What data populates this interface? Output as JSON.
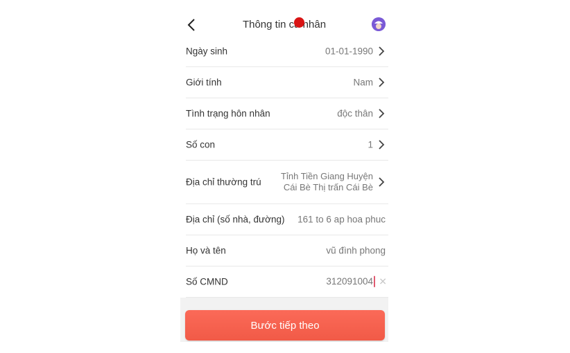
{
  "header": {
    "title": "Thông tin cá nhân"
  },
  "fields": [
    {
      "label": "Ngày sinh",
      "value": "01-01-1990"
    },
    {
      "label": "Giới tính",
      "value": "Nam"
    },
    {
      "label": "Tình trạng hôn nhân",
      "value": "độc thân"
    },
    {
      "label": "Số con",
      "value": "1"
    },
    {
      "label": "Địa chỉ thường trú",
      "value_line1": "Tỉnh Tiền Giang Huyện",
      "value_line2": "Cái Bè Thị trấn Cái Bè"
    },
    {
      "label": "Địa chỉ (số nhà, đường)",
      "value": "161 to 6 ap hoa phuc"
    },
    {
      "label": "Họ và tên",
      "value": "vũ đình phong"
    },
    {
      "label": "Số CMND",
      "value": "312091004"
    }
  ],
  "footer": {
    "next_label": "Bước tiếp theo"
  },
  "icons": {
    "back": "chevron-left-icon",
    "avatar": "avatar-icon",
    "row_arrow": "chevron-right-icon",
    "clear": "close-icon"
  },
  "colors": {
    "button": "#f15a47",
    "record_dot": "#d91414",
    "avatar": "#7a5ad6"
  }
}
